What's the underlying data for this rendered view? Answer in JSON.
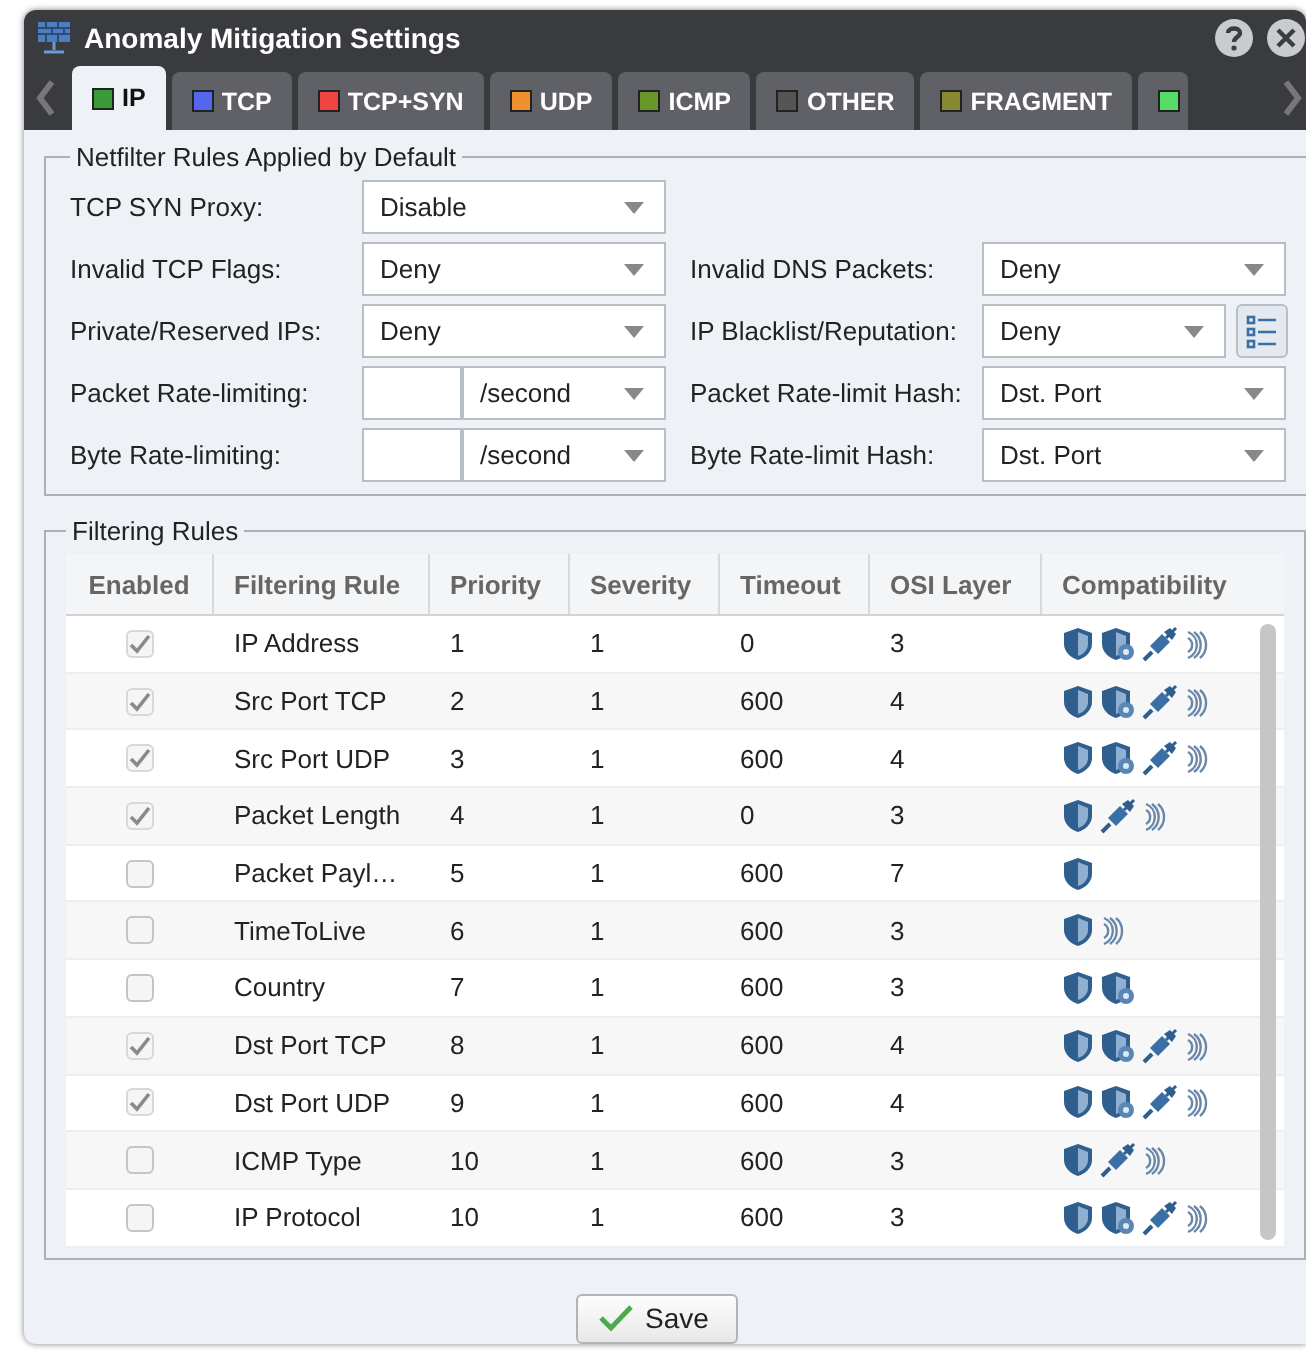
{
  "window": {
    "title": "Anomaly Mitigation Settings"
  },
  "tabs": [
    {
      "label": "IP",
      "color": "#3a9a3a",
      "selected": true
    },
    {
      "label": "TCP",
      "color": "#5566ee",
      "selected": false
    },
    {
      "label": "TCP+SYN",
      "color": "#ee4444",
      "selected": false
    },
    {
      "label": "UDP",
      "color": "#f09030",
      "selected": false
    },
    {
      "label": "ICMP",
      "color": "#66992a",
      "selected": false
    },
    {
      "label": "OTHER",
      "color": "#555555",
      "selected": false
    },
    {
      "label": "FRAGMENT",
      "color": "#888833",
      "selected": false
    },
    {
      "color": "#55dd66",
      "selected": false
    }
  ],
  "netfilter": {
    "legend": "Netfilter Rules Applied by Default",
    "rows": [
      [
        {
          "kind": "select",
          "label": "TCP SYN Proxy:",
          "value": "Disable"
        }
      ],
      [
        {
          "kind": "select",
          "label": "Invalid TCP Flags:",
          "value": "Deny"
        },
        {
          "kind": "select",
          "label": "Invalid DNS Packets:",
          "value": "Deny"
        }
      ],
      [
        {
          "kind": "select",
          "label": "Private/Reserved IPs:",
          "value": "Deny"
        },
        {
          "kind": "select-list",
          "label": "IP Blacklist/Reputation:",
          "value": "Deny"
        }
      ],
      [
        {
          "kind": "rate",
          "label": "Packet Rate-limiting:",
          "unit": "/second"
        },
        {
          "kind": "select",
          "label": "Packet Rate-limit Hash:",
          "value": "Dst. Port"
        }
      ],
      [
        {
          "kind": "rate",
          "label": "Byte Rate-limiting:",
          "unit": "/second"
        },
        {
          "kind": "select",
          "label": "Byte Rate-limit Hash:",
          "value": "Dst. Port"
        }
      ]
    ]
  },
  "filtering": {
    "legend": "Filtering Rules",
    "columns": [
      "Enabled",
      "Filtering Rule",
      "Priority",
      "Severity",
      "Timeout",
      "OSI Layer",
      "Compatibility"
    ],
    "rows": [
      {
        "enabled": true,
        "rule": "IP Address",
        "priority": "1",
        "severity": "1",
        "timeout": "0",
        "osi": "3",
        "compat": [
          {
            "kind": "shield"
          },
          {
            "kind": "shield-gear"
          },
          {
            "kind": "plug"
          },
          {
            "kind": "waves"
          }
        ]
      },
      {
        "enabled": true,
        "rule": "Src Port TCP",
        "priority": "2",
        "severity": "1",
        "timeout": "600",
        "osi": "4",
        "compat": [
          {
            "kind": "shield"
          },
          {
            "kind": "shield-gear"
          },
          {
            "kind": "plug"
          },
          {
            "kind": "waves"
          }
        ]
      },
      {
        "enabled": true,
        "rule": "Src Port UDP",
        "priority": "3",
        "severity": "1",
        "timeout": "600",
        "osi": "4",
        "compat": [
          {
            "kind": "shield"
          },
          {
            "kind": "shield-gear"
          },
          {
            "kind": "plug"
          },
          {
            "kind": "waves"
          }
        ]
      },
      {
        "enabled": true,
        "rule": "Packet Length",
        "priority": "4",
        "severity": "1",
        "timeout": "0",
        "osi": "3",
        "compat": [
          {
            "kind": "shield"
          },
          {
            "kind": "plug"
          },
          {
            "kind": "waves"
          }
        ]
      },
      {
        "enabled": false,
        "rule": "Packet Payl…",
        "priority": "5",
        "severity": "1",
        "timeout": "600",
        "osi": "7",
        "compat": [
          {
            "kind": "shield"
          }
        ]
      },
      {
        "enabled": false,
        "rule": "TimeToLive",
        "priority": "6",
        "severity": "1",
        "timeout": "600",
        "osi": "3",
        "compat": [
          {
            "kind": "shield"
          },
          {
            "kind": "waves"
          }
        ]
      },
      {
        "enabled": false,
        "rule": "Country",
        "priority": "7",
        "severity": "1",
        "timeout": "600",
        "osi": "3",
        "compat": [
          {
            "kind": "shield"
          },
          {
            "kind": "shield-gear"
          }
        ]
      },
      {
        "enabled": true,
        "rule": "Dst Port TCP",
        "priority": "8",
        "severity": "1",
        "timeout": "600",
        "osi": "4",
        "compat": [
          {
            "kind": "shield"
          },
          {
            "kind": "shield-gear"
          },
          {
            "kind": "plug"
          },
          {
            "kind": "waves"
          }
        ]
      },
      {
        "enabled": true,
        "rule": "Dst Port UDP",
        "priority": "9",
        "severity": "1",
        "timeout": "600",
        "osi": "4",
        "compat": [
          {
            "kind": "shield"
          },
          {
            "kind": "shield-gear"
          },
          {
            "kind": "plug"
          },
          {
            "kind": "waves"
          }
        ]
      },
      {
        "enabled": false,
        "rule": "ICMP Type",
        "priority": "10",
        "severity": "1",
        "timeout": "600",
        "osi": "3",
        "compat": [
          {
            "kind": "shield"
          },
          {
            "kind": "plug"
          },
          {
            "kind": "waves"
          }
        ]
      },
      {
        "enabled": false,
        "rule": "IP Protocol",
        "priority": "10",
        "severity": "1",
        "timeout": "600",
        "osi": "3",
        "compat": [
          {
            "kind": "shield"
          },
          {
            "kind": "shield-gear"
          },
          {
            "kind": "plug"
          },
          {
            "kind": "waves"
          }
        ]
      }
    ]
  },
  "save_button": "Save"
}
